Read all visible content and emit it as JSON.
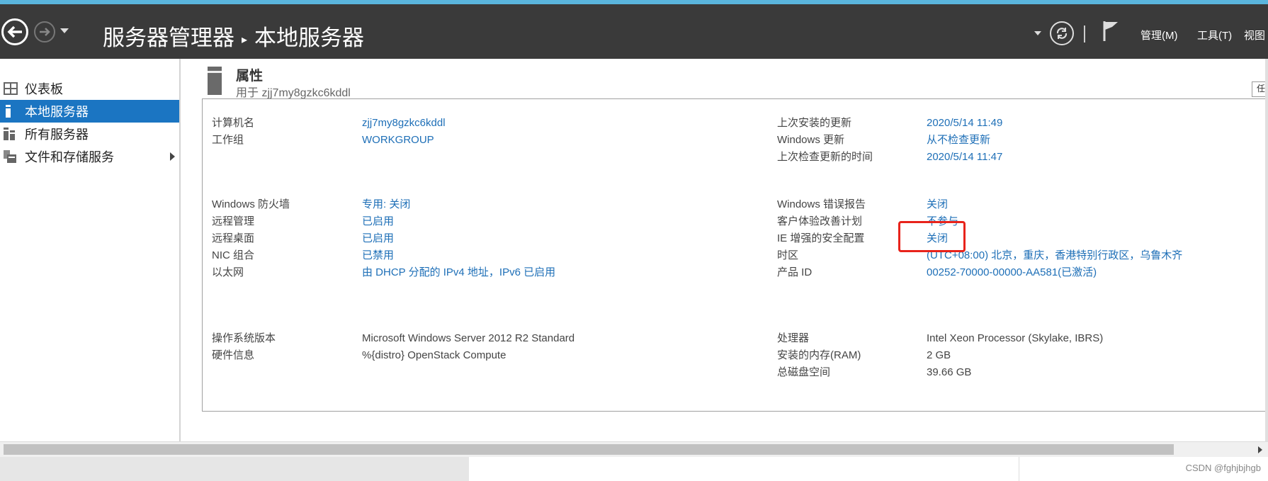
{
  "titlebar": {
    "breadcrumb_app": "服务器管理器",
    "breadcrumb_page": "本地服务器",
    "menus": [
      "管理(M)",
      "工具(T)",
      "视图"
    ]
  },
  "sidebar": {
    "items": [
      {
        "label": "仪表板",
        "icon": "dashboard-icon"
      },
      {
        "label": "本地服务器",
        "icon": "server-icon",
        "active": true
      },
      {
        "label": "所有服务器",
        "icon": "servers-icon"
      },
      {
        "label": "文件和存储服务",
        "icon": "storage-icon",
        "expandable": true
      }
    ]
  },
  "properties": {
    "title": "属性",
    "subtitle": "用于 zjj7my8gzkc6kddl",
    "task_button": "任",
    "left": [
      {
        "label": "计算机名",
        "value": "zjj7my8gzkc6kddl",
        "link": true
      },
      {
        "label": "工作组",
        "value": "WORKGROUP",
        "link": true
      },
      {
        "label": "Windows 防火墙",
        "value": "专用: 关闭",
        "link": true
      },
      {
        "label": "远程管理",
        "value": "已启用",
        "link": true
      },
      {
        "label": "远程桌面",
        "value": "已启用",
        "link": true
      },
      {
        "label": "NIC 组合",
        "value": "已禁用",
        "link": true
      },
      {
        "label": "以太网",
        "value": "由 DHCP 分配的 IPv4 地址，IPv6 已启用",
        "link": true
      },
      {
        "label": "操作系统版本",
        "value": "Microsoft Windows Server 2012 R2 Standard",
        "link": false
      },
      {
        "label": "硬件信息",
        "value": "%{distro} OpenStack Compute",
        "link": false
      }
    ],
    "right": [
      {
        "label": "上次安装的更新",
        "value": "2020/5/14 11:49",
        "link": true
      },
      {
        "label": "Windows 更新",
        "value": "从不检查更新",
        "link": true
      },
      {
        "label": "上次检查更新的时间",
        "value": "2020/5/14 11:47",
        "link": true
      },
      {
        "label": "Windows 错误报告",
        "value": "关闭",
        "link": true
      },
      {
        "label": "客户体验改善计划",
        "value": "不参与",
        "link": true
      },
      {
        "label": "IE 增强的安全配置",
        "value": "关闭",
        "link": true
      },
      {
        "label": "时区",
        "value": "(UTC+08:00) 北京，重庆，香港特别行政区，乌鲁木齐",
        "link": true
      },
      {
        "label": "产品 ID",
        "value": "00252-70000-00000-AA581(已激活)",
        "link": true
      },
      {
        "label": "处理器",
        "value": "Intel Xeon Processor (Skylake, IBRS)",
        "link": false
      },
      {
        "label": "安装的内存(RAM)",
        "value": "2 GB",
        "link": false
      },
      {
        "label": "总磁盘空间",
        "value": "39.66 GB",
        "link": false
      }
    ]
  },
  "watermark": "CSDN @fghjbjhgb",
  "colors": {
    "accent": "#1b75c2",
    "link": "#1e6fb7",
    "titlebar": "#3a3a3a",
    "highlight": "#e8231b"
  }
}
